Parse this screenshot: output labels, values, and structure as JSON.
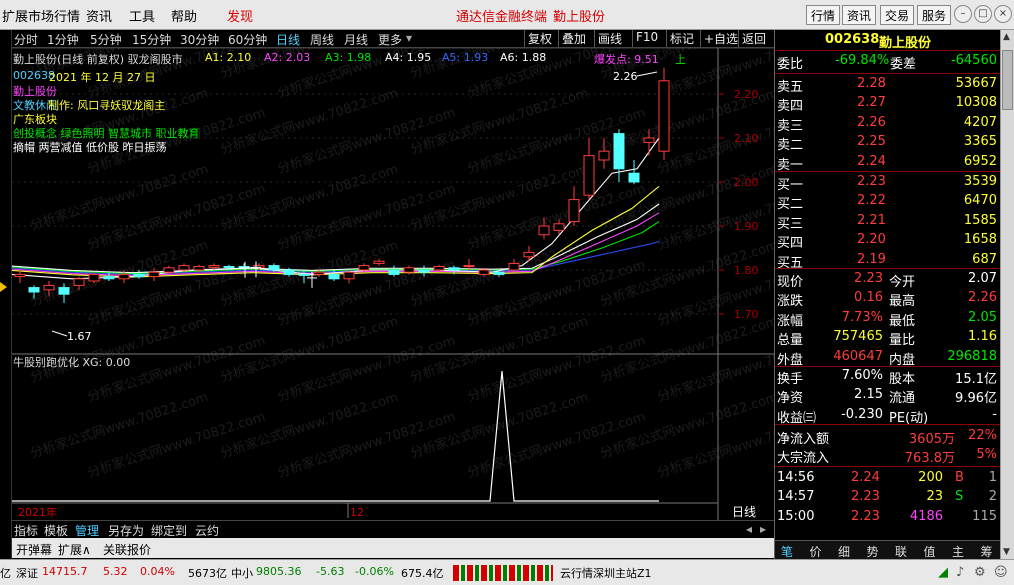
{
  "menu": {
    "items": [
      "扩展市场行情",
      "资讯",
      "工具",
      "帮助",
      "发现"
    ],
    "center_items": [
      "通达信金融终端",
      "勤上股份"
    ],
    "right_buttons": [
      "行情",
      "资讯",
      "交易",
      "服务"
    ]
  },
  "period_bar": {
    "periods": [
      "分时",
      "1分钟",
      "5分钟",
      "15分钟",
      "30分钟",
      "60分钟",
      "日线",
      "周线",
      "月线",
      "更多"
    ],
    "active": "日线",
    "tools": [
      "复权",
      "叠加",
      "画线",
      "F10",
      "标记",
      "+自选",
      "返回"
    ]
  },
  "chart": {
    "title": "勤上股份(日线 前复权) 驭龙阁股市",
    "ma_labels": [
      {
        "text": "A1: 2.10",
        "color": "#ffff33"
      },
      {
        "text": "A2: 2.03",
        "color": "#ff44ff"
      },
      {
        "text": "A3: 1.98",
        "color": "#00e600"
      },
      {
        "text": "A4: 1.95",
        "color": "#ffffff"
      },
      {
        "text": "A5: 1.93",
        "color": "#3366ff"
      },
      {
        "text": "A6: 1.88",
        "color": "#ffffff"
      }
    ],
    "bao_fa_dian": "爆发点: 9.51",
    "up_marker": "上",
    "info_lines": [
      {
        "text": "002638",
        "color": "#4fd0ff"
      },
      {
        "text": "2021 年 12 月 27 日",
        "color": "#ffff33"
      },
      {
        "text": "勤上股份",
        "color": "#ff44ff"
      },
      {
        "text": "文教休闲",
        "color": "#4fd0ff"
      },
      {
        "text": "制作: 风口寻妖驭龙阁主",
        "color": "#ffff33"
      },
      {
        "text": "广东板块",
        "color": "#ffff33"
      },
      {
        "text": "创投概念 绿色照明 智慧城市 职业教育",
        "color": "#00e600"
      },
      {
        "text": "摘帽 两营减值 低价股 昨日振荡",
        "color": "#ffffff"
      }
    ],
    "watermark": "分析家公式网www.70822.com",
    "y_ticks": [
      "2.20",
      "2.10",
      "2.00",
      "1.90",
      "1.80",
      "1.70"
    ],
    "high_marker": "2.26",
    "low_marker": "1.67",
    "x_labels": [
      "2021年",
      "12"
    ],
    "period_label": "日线"
  },
  "indicator": {
    "title": "牛股别跑优化 XG: 0.00"
  },
  "bottom_tabs": {
    "items": [
      "指标",
      "模板",
      "管理",
      "另存为",
      "绑定到",
      "云约"
    ],
    "active": "管理"
  },
  "bottom_toolbar": [
    "开弹幕",
    "扩展∧",
    "关联报价"
  ],
  "status_bar": {
    "lead": "亿",
    "sz_label": "深证",
    "sz_index": "14715.7",
    "sz_change": "5.32",
    "sz_pct": "0.04%",
    "sz_amount": "5673亿",
    "zx_label": "中小",
    "zx_index": "9805.36",
    "zx_change": "-5.63",
    "zx_pct": "-0.06%",
    "zx_amount": "675.4亿",
    "server": "云行情深圳主站Z1"
  },
  "quote": {
    "code": "002638",
    "name": "勤上股份",
    "weibi_label": "委比",
    "weibi": "-69.84%",
    "weicha_label": "委差",
    "weicha": "-64560",
    "sells": [
      {
        "label": "卖五",
        "price": "2.28",
        "vol": "53667"
      },
      {
        "label": "卖四",
        "price": "2.27",
        "vol": "10308"
      },
      {
        "label": "卖三",
        "price": "2.26",
        "vol": "4207"
      },
      {
        "label": "卖二",
        "price": "2.25",
        "vol": "3365"
      },
      {
        "label": "卖一",
        "price": "2.24",
        "vol": "6952"
      }
    ],
    "buys": [
      {
        "label": "买一",
        "price": "2.23",
        "vol": "3539"
      },
      {
        "label": "买二",
        "price": "2.22",
        "vol": "6470"
      },
      {
        "label": "买三",
        "price": "2.21",
        "vol": "1585"
      },
      {
        "label": "买四",
        "price": "2.20",
        "vol": "1658"
      },
      {
        "label": "买五",
        "price": "2.19",
        "vol": "687"
      }
    ],
    "stats": [
      {
        "l1": "现价",
        "v1": "2.23",
        "c1": "#ff3c3c",
        "l2": "今开",
        "v2": "2.07",
        "c2": "#ffffff"
      },
      {
        "l1": "涨跌",
        "v1": "0.16",
        "c1": "#ff3c3c",
        "l2": "最高",
        "v2": "2.26",
        "c2": "#ff3c3c"
      },
      {
        "l1": "涨幅",
        "v1": "7.73%",
        "c1": "#ff3c3c",
        "l2": "最低",
        "v2": "2.05",
        "c2": "#00e600"
      },
      {
        "l1": "总量",
        "v1": "757465",
        "c1": "#ffff33",
        "l2": "量比",
        "v2": "1.16",
        "c2": "#ffff33"
      },
      {
        "l1": "外盘",
        "v1": "460647",
        "c1": "#ff3c3c",
        "l2": "内盘",
        "v2": "296818",
        "c2": "#00e600"
      }
    ],
    "stats2": [
      {
        "l1": "换手",
        "v1": "7.60%",
        "l2": "股本",
        "v2": "15.1亿"
      },
      {
        "l1": "净资",
        "v1": "2.15",
        "l2": "流通",
        "v2": "9.96亿"
      },
      {
        "l1": "收益㈢",
        "v1": "-0.230",
        "l2": "PE(动)",
        "v2": "-"
      }
    ],
    "flows": [
      {
        "label": "净流入额",
        "value": "3605万",
        "pct": "22%"
      },
      {
        "label": "大宗流入",
        "value": "763.8万",
        "pct": "5%"
      }
    ],
    "ticks": [
      {
        "time": "14:56",
        "price": "2.24",
        "vol": "200",
        "vc": "#ffff33",
        "side": "B",
        "sc": "#ff3c3c",
        "n": "1"
      },
      {
        "time": "14:57",
        "price": "2.23",
        "vol": "23",
        "vc": "#ffff33",
        "side": "S",
        "sc": "#00e600",
        "n": "2"
      },
      {
        "time": "15:00",
        "price": "2.23",
        "vol": "4186",
        "vc": "#ff44ff",
        "side": "",
        "sc": "#fff",
        "n": "115"
      }
    ],
    "bottom_tabs": [
      "笔",
      "价",
      "细",
      "势",
      "联",
      "值",
      "主",
      "筹"
    ]
  }
}
